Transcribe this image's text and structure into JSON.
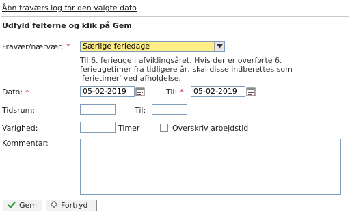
{
  "header": {
    "log_link": "Åbn fraværs log for den valgte dato",
    "instruction": "Udfyld felterne og klik på Gem"
  },
  "form": {
    "absence_label": "Fravær/nærvær:",
    "absence_value": "Særlige feriedage",
    "help_text": [
      "Til 6. ferieuge i afviklingsåret. Hvis der er overførte 6.",
      "ferieugetimer fra tidligere år, skal disse indberettes som",
      "'ferietimer' ved afholdelse."
    ],
    "date_label": "Dato:",
    "date_value": "05-02-2019",
    "to_label": "Til:",
    "to_date_value": "05-02-2019",
    "timespan_label": "Tidsrum:",
    "timespan_from": "",
    "timespan_to_label": "Til:",
    "timespan_to": "",
    "duration_label": "Varighed:",
    "duration_value": "",
    "hours_label": "Timer",
    "override_label": "Overskriv arbejdstid",
    "override_checked": false,
    "comment_label": "Kommentar:",
    "comment_value": "",
    "required_marker": "*"
  },
  "buttons": {
    "save_label": "Gem",
    "cancel_label": "Fortryd"
  },
  "icons": {
    "select_arrow": "chevron-down-icon",
    "calendar": "calendar-icon",
    "save": "checkmark-icon",
    "cancel": "diamond-icon"
  },
  "colors": {
    "required": "#c0172b",
    "selected_field_bg": "#ffee88",
    "save_check": "#2e9a2e"
  }
}
